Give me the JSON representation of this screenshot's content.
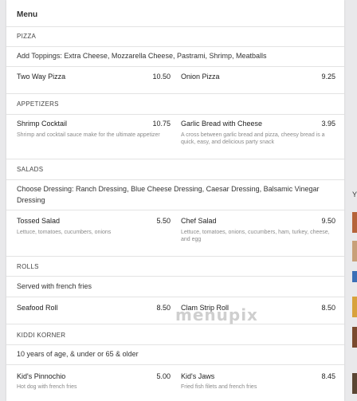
{
  "menu": {
    "title": "Menu"
  },
  "sections": [
    {
      "label": "PIZZA",
      "note": "Add Toppings: Extra Cheese, Mozzarella Cheese, Pastrami, Shrimp, Meatballs",
      "items": [
        {
          "name": "Two Way Pizza",
          "price": "10.50",
          "desc": ""
        },
        {
          "name": "Onion Pizza",
          "price": "9.25",
          "desc": ""
        }
      ]
    },
    {
      "label": "APPETIZERS",
      "note": "",
      "items": [
        {
          "name": "Shrimp Cocktail",
          "price": "10.75",
          "desc": "Shrimp and cocktail sauce make for the ultimate appetizer"
        },
        {
          "name": "Garlic Bread with Cheese",
          "price": "3.95",
          "desc": "A cross between garlic bread and pizza, cheesy bread is a quick, easy, and delicious party snack"
        }
      ]
    },
    {
      "label": "SALADS",
      "note": "Choose Dressing: Ranch Dressing, Blue Cheese Dressing, Caesar Dressing, Balsamic Vinegar Dressing",
      "items": [
        {
          "name": "Tossed Salad",
          "price": "5.50",
          "desc": "Lettuce, tomatoes, cucumbers, onions"
        },
        {
          "name": "Chef Salad",
          "price": "9.50",
          "desc": "Lettuce, tomatoes, onions, cucumbers, ham, turkey, cheese, and egg"
        }
      ]
    },
    {
      "label": "ROLLS",
      "note": "Served with french fries",
      "items": [
        {
          "name": "Seafood Roll",
          "price": "8.50",
          "desc": ""
        },
        {
          "name": "Clam Strip Roll",
          "price": "8.50",
          "desc": ""
        }
      ]
    },
    {
      "label": "KIDDI KORNER",
      "note": "10 years of age, & under or 65 & older",
      "items": [
        {
          "name": "Kid's Pinnochio",
          "price": "5.00",
          "desc": "Hot dog with french fries"
        },
        {
          "name": "Kid's Jaws",
          "price": "8.45",
          "desc": "Fried fish filets and french fries"
        }
      ]
    }
  ],
  "watermark": "menupix",
  "side": {
    "letter": "Y"
  }
}
